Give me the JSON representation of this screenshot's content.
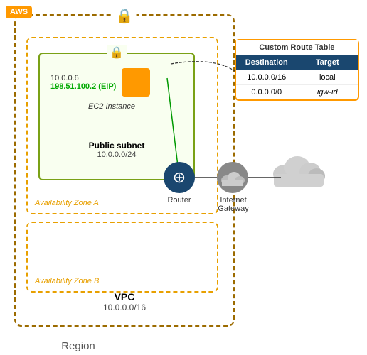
{
  "aws_badge": "AWS",
  "vpc": {
    "label": "VPC",
    "cidr": "10.0.0.0/16"
  },
  "region_label": "Region",
  "az_a_label": "Availability Zone A",
  "az_b_label": "Availability Zone B",
  "subnet": {
    "label": "Public subnet",
    "cidr": "10.0.0.0/24"
  },
  "ec2": {
    "ip": "10.0.0.6",
    "eip": "198.51.100.2 (EIP)",
    "instance_label": "EC2 Instance"
  },
  "router": {
    "label": "Router"
  },
  "igw": {
    "label": "Internet Gateway"
  },
  "route_table": {
    "title": "Custom Route Table",
    "headers": [
      "Destination",
      "Target"
    ],
    "rows": [
      {
        "destination": "10.0.0.0/16",
        "target": "local"
      },
      {
        "destination": "0.0.0.0/0",
        "target": "igw-id"
      }
    ]
  }
}
